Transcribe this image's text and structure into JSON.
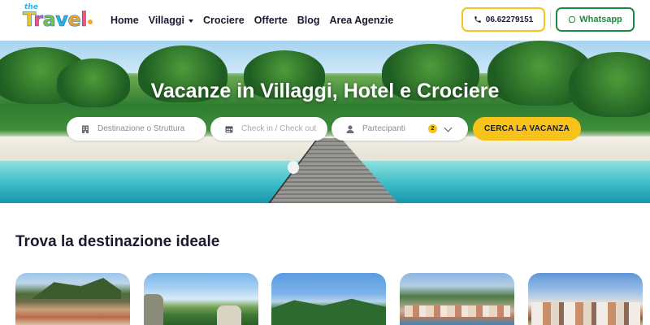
{
  "logo": {
    "the": "the",
    "word": "Travel"
  },
  "nav": {
    "items": [
      {
        "label": "Home",
        "has_dropdown": false
      },
      {
        "label": "Villaggi",
        "has_dropdown": true
      },
      {
        "label": "Crociere",
        "has_dropdown": false
      },
      {
        "label": "Offerte",
        "has_dropdown": false
      },
      {
        "label": "Blog",
        "has_dropdown": false
      },
      {
        "label": "Area Agenzie",
        "has_dropdown": false
      }
    ]
  },
  "header": {
    "phone_label": "06.62279151",
    "whatsapp_label": "Whatsapp",
    "phone_icon": "phone-icon",
    "whatsapp_icon": "whatsapp-icon"
  },
  "hero": {
    "title": "Vacanze in Villaggi, Hotel e Crociere"
  },
  "search": {
    "destination_placeholder": "Destinazione o Struttura",
    "dates_placeholder": "Check in / Check out",
    "participants_label": "Partecipanti",
    "participants_count": "2",
    "submit_label": "CERCA LA VACANZA"
  },
  "destinations": {
    "title": "Trova la destinazione ideale",
    "cards": [
      "card-1",
      "card-2",
      "card-3",
      "card-4",
      "card-5"
    ]
  },
  "colors": {
    "accent_yellow": "#f7c21a",
    "whatsapp_green": "#1e8a3c",
    "text_dark": "#1a1a2e"
  }
}
